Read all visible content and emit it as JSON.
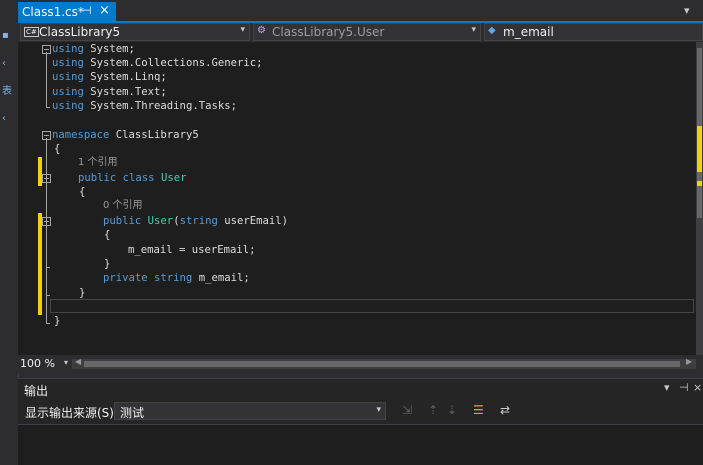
{
  "document_tab": {
    "title": "Class1.cs*",
    "pin_glyph": "⊣",
    "close_glyph": "×"
  },
  "nav": {
    "project": "ClassLibrary5",
    "type": "ClassLibrary5.User",
    "member": "m_email",
    "project_icon": "C#"
  },
  "code": {
    "line1": [
      "using",
      " System;"
    ],
    "line2": [
      "using",
      " System.Collections.Generic;"
    ],
    "line3": [
      "using",
      " System.Linq;"
    ],
    "line4": [
      "using",
      " System.Text;"
    ],
    "line5": [
      "using",
      " System.Threading.Tasks;"
    ],
    "line7": [
      "namespace",
      " ClassLibrary5"
    ],
    "line8": "{",
    "lens1": "1 个引用",
    "line9": [
      "public",
      " ",
      "class",
      " ",
      "User"
    ],
    "line10": "{",
    "lens2": "0 个引用",
    "line11": [
      "public",
      " ",
      "User",
      "(",
      "string",
      " userEmail)"
    ],
    "line12": "{",
    "line13": "m_email = userEmail;",
    "line14": "}",
    "line15": [
      "private",
      " ",
      "string",
      " m_email;"
    ],
    "line16": "}",
    "line18": "}"
  },
  "zoom": "100 %",
  "output": {
    "title": "输出",
    "source_label": "显示输出来源(S):",
    "source_value": "测试",
    "controls": [
      "▾",
      "⊣",
      "×"
    ]
  },
  "colors": {
    "accent": "#007acc",
    "keyword": "#569cd6",
    "type": "#4ec9b0",
    "change_marker": "#efd10f"
  }
}
